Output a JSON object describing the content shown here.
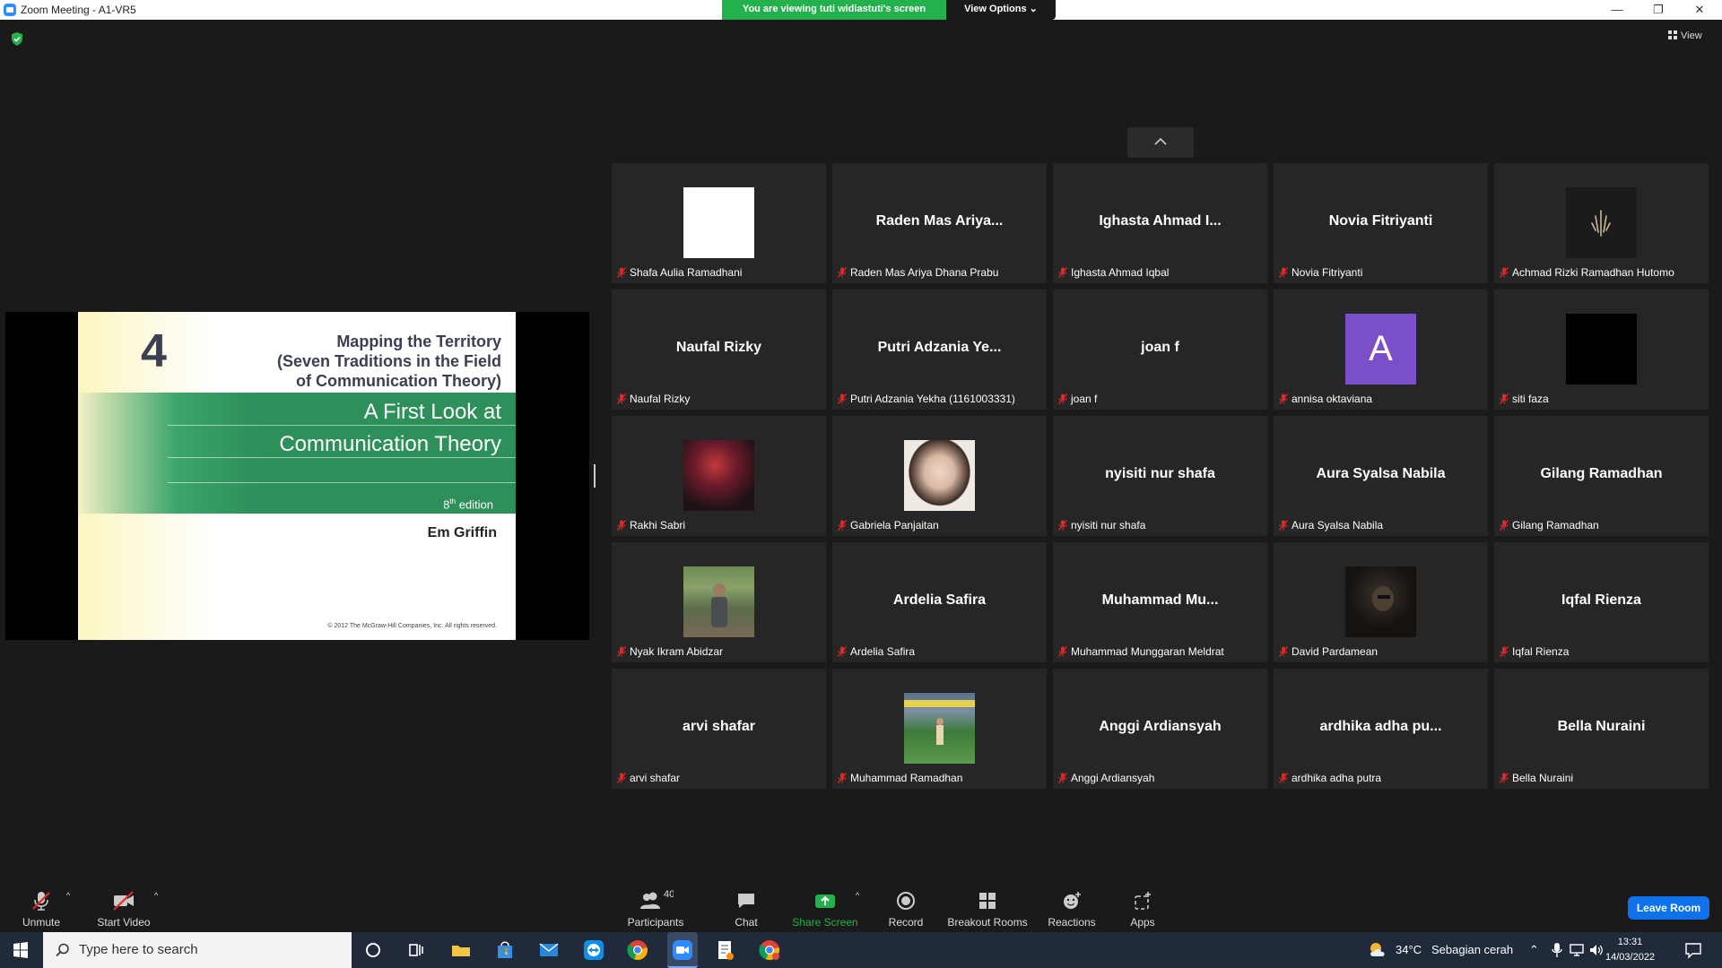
{
  "window": {
    "title": "Zoom Meeting - A1-VR5",
    "viewing_banner": "You are viewing tuti widiastuti's screen",
    "view_options": "View Options",
    "minimize": "—",
    "maximize": "❐",
    "close": "✕",
    "view_label": "View"
  },
  "slide": {
    "number": "4",
    "title_line1": "Mapping the Territory",
    "title_line2": "(Seven Traditions in the Field",
    "title_line3": "of Communication Theory)",
    "subtitle_line1": "A First Look at",
    "subtitle_line2": "Communication Theory",
    "edition_num": "8",
    "edition_sup": "th",
    "edition_word": " edition",
    "author": "Em Griffin",
    "copyright": "© 2012 The McGraw-Hill Companies, Inc. All rights reserved."
  },
  "participants": [
    {
      "big": "",
      "label": "Shafa Aulia Ramadhani",
      "avatar": "white"
    },
    {
      "big": "Raden Mas Ariya...",
      "label": "Raden Mas Ariya Dhana Prabu"
    },
    {
      "big": "Ighasta Ahmad I...",
      "label": "Ighasta Ahmad Iqbal"
    },
    {
      "big": "Novia Fitriyanti",
      "label": "Novia Fitriyanti"
    },
    {
      "big": "",
      "label": "Achmad Rizki Ramadhan Hutomo",
      "avatar": "dark-ornament"
    },
    {
      "big": "Naufal Rizky",
      "label": "Naufal Rizky"
    },
    {
      "big": "Putri Adzania Ye...",
      "label": "Putri Adzania Yekha (1161003331)"
    },
    {
      "big": "joan f",
      "label": "joan f"
    },
    {
      "big": "",
      "label": "annisa oktaviana",
      "avatar": "letter",
      "letter": "A"
    },
    {
      "big": "",
      "label": "siti faza",
      "avatar": "black"
    },
    {
      "big": "",
      "label": "Rakhi Sabri",
      "avatar": "photo-red"
    },
    {
      "big": "",
      "label": "Gabriela Panjaitan",
      "avatar": "photo-girl"
    },
    {
      "big": "nyisiti nur shafa",
      "label": "nyisiti nur shafa"
    },
    {
      "big": "Aura Syalsa Nabila",
      "label": "Aura Syalsa Nabila"
    },
    {
      "big": "Gilang Ramadhan",
      "label": "Gilang Ramadhan"
    },
    {
      "big": "",
      "label": "Nyak Ikram Abidzar",
      "avatar": "photo-outdoor"
    },
    {
      "big": "Ardelia Safira",
      "label": "Ardelia Safira"
    },
    {
      "big": "Muhammad  Mu...",
      "label": "Muhammad Munggaran Meldrat"
    },
    {
      "big": "",
      "label": "David Pardamean",
      "avatar": "photo-dark"
    },
    {
      "big": "Iqfal Rienza",
      "label": "Iqfal Rienza"
    },
    {
      "big": "arvi shafar",
      "label": "arvi shafar"
    },
    {
      "big": "",
      "label": "Muhammad Ramadhan",
      "avatar": "photo-field"
    },
    {
      "big": "Anggi Ardiansyah",
      "label": "Anggi Ardiansyah"
    },
    {
      "big": "ardhika adha pu...",
      "label": "ardhika adha putra"
    },
    {
      "big": "Bella Nuraini",
      "label": "Bella Nuraini"
    }
  ],
  "toolbar": {
    "unmute": "Unmute",
    "start_video": "Start Video",
    "participants": "Participants",
    "participants_count": "40",
    "chat": "Chat",
    "share_screen": "Share Screen",
    "record": "Record",
    "breakout_rooms": "Breakout Rooms",
    "reactions": "Reactions",
    "apps": "Apps",
    "leave_room": "Leave Room"
  },
  "taskbar": {
    "search_placeholder": "Type here to search",
    "temperature": "34°C",
    "weather": "Sebagian cerah",
    "time": "13:31",
    "date": "14/03/2022"
  },
  "colors": {
    "banner_green": "#23b14d",
    "slide_green": "#2d8f5a",
    "leave_blue": "#0e72ed",
    "muted_red": "#e02828",
    "letter_avatar": "#7b4fc9"
  }
}
